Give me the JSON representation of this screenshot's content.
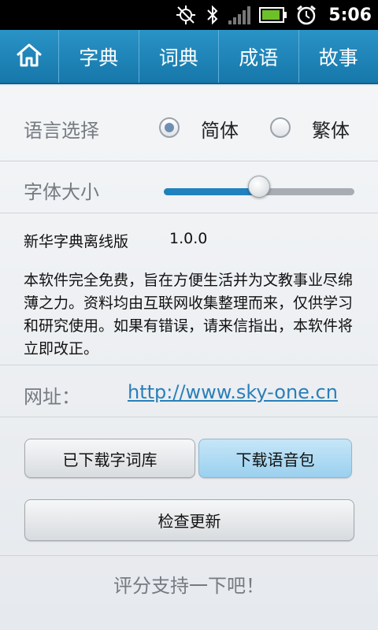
{
  "status_bar": {
    "time": "5:06",
    "icons": [
      "gps-off-icon",
      "bluetooth-icon",
      "signal-icon",
      "battery-icon",
      "alarm-icon"
    ]
  },
  "nav": {
    "home_icon": "home-icon",
    "tabs": [
      {
        "label": "字典"
      },
      {
        "label": "词典"
      },
      {
        "label": "成语"
      },
      {
        "label": "故事"
      }
    ]
  },
  "settings": {
    "language": {
      "label": "语言选择",
      "options": [
        {
          "label": "简体",
          "selected": true
        },
        {
          "label": "繁体",
          "selected": false
        }
      ]
    },
    "font_size": {
      "label": "字体大小",
      "level": 0.5
    }
  },
  "about": {
    "app_name": "新华字典离线版",
    "version": "1.0.0",
    "description": "本软件完全免费，旨在方便生活并为文教事业尽绵薄之力。资料均由互联网收集整理而来，仅供学习和研究使用。如果有错误，请来信指出，本软件将立即改正。"
  },
  "website": {
    "label": "网址：",
    "url": "http://www.sky-one.cn"
  },
  "buttons": {
    "downloaded_lib": "已下载字词库",
    "download_voice": "下载语音包",
    "check_update": "检查更新"
  },
  "rate": {
    "text": "评分支持一下吧！"
  },
  "colors": {
    "nav_blue": "#1f82bf",
    "link_blue": "#2a7fb8",
    "active_button": "#a9d7f2"
  }
}
